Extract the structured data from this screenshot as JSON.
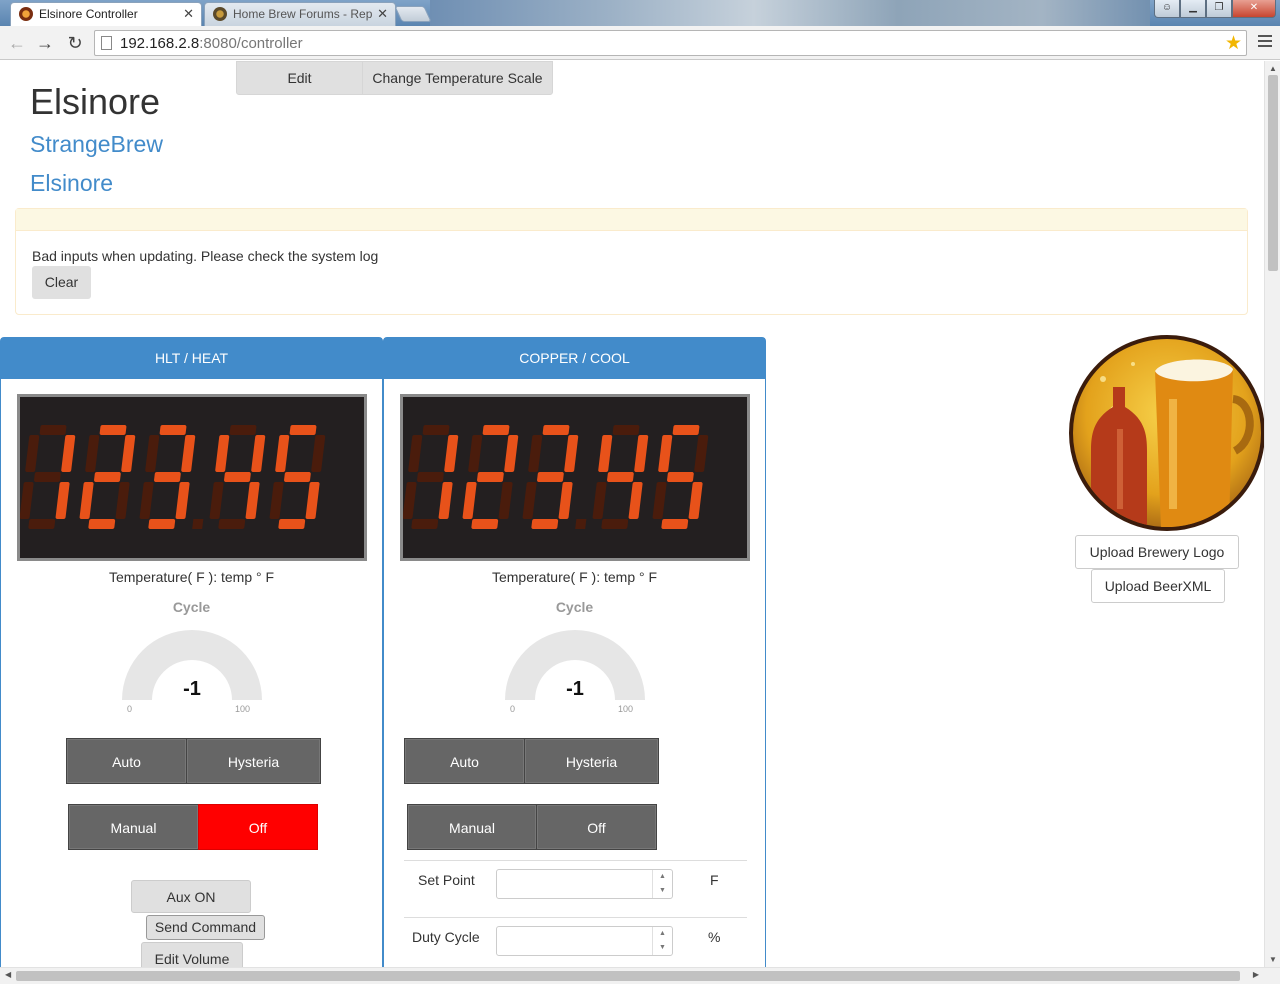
{
  "browser": {
    "tabs": [
      {
        "title": "Elsinore Controller",
        "active": true
      },
      {
        "title": "Home Brew Forums - Rep",
        "active": false
      }
    ],
    "url_host": "192.168.2.8",
    "url_rest": ":8080/controller"
  },
  "header": {
    "brand": "Elsinore",
    "links": [
      "StrangeBrew",
      "Elsinore"
    ],
    "edit_label": "Edit",
    "scale_label": "Change Temperature Scale"
  },
  "alert": {
    "message": "Bad inputs when updating. Please check the system log",
    "clear_label": "Clear"
  },
  "devices": [
    {
      "name": "HLT / HEAT",
      "display_digits": "123.45",
      "temp_label": "Temperature( F ): temp ° F",
      "cycle_label": "Cycle",
      "gauge": {
        "value": "-1",
        "min": "0",
        "max": "100",
        "fraction": 0
      },
      "mode_buttons": [
        "Auto",
        "Hysteria"
      ],
      "state_buttons": [
        "Manual",
        "Off"
      ],
      "off_active": true,
      "extra_buttons": [
        "Aux ON",
        "Send Command",
        "Edit Volume"
      ]
    },
    {
      "name": "COPPER / COOL",
      "display_digits": "123.45",
      "temp_label": "Temperature( F ): temp ° F",
      "cycle_label": "Cycle",
      "gauge": {
        "value": "-1",
        "min": "0",
        "max": "100",
        "fraction": 0
      },
      "mode_buttons": [
        "Auto",
        "Hysteria"
      ],
      "state_buttons": [
        "Manual",
        "Off"
      ],
      "off_active": false,
      "fields": [
        {
          "label": "Set Point",
          "value": "",
          "unit": "F"
        },
        {
          "label": "Duty Cycle",
          "value": "",
          "unit": "%"
        }
      ]
    }
  ],
  "sidebar": {
    "upload_logo_label": "Upload Brewery Logo",
    "upload_beerxml_label": "Upload BeerXML"
  },
  "colors": {
    "accent": "#428bca",
    "off_active": "#ff0000",
    "segment_on": "#e8521a",
    "segment_off": "#4a1c0c"
  }
}
